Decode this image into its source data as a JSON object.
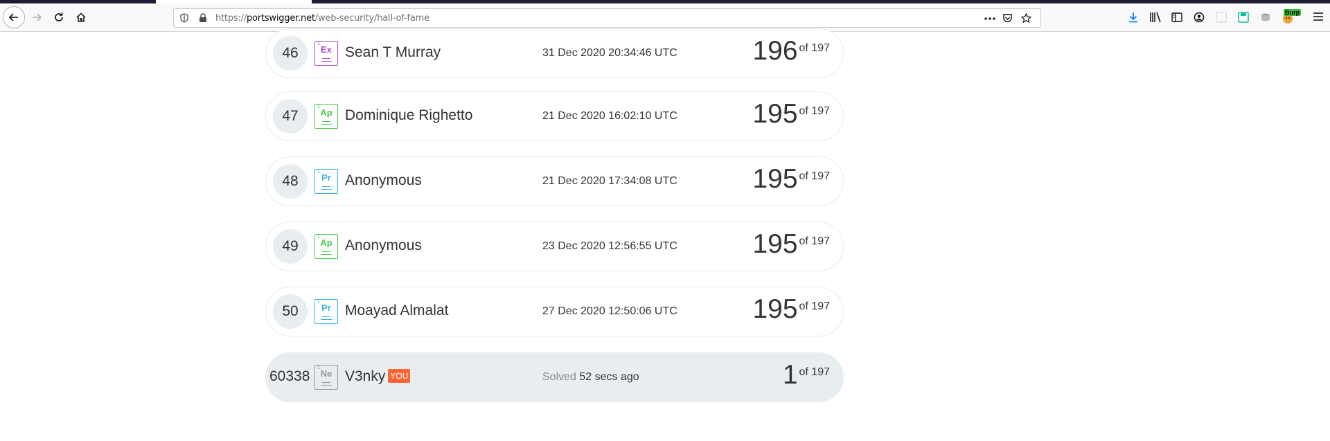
{
  "browser": {
    "url_prefix": "https://",
    "url_host": "portswigger.net",
    "url_path": "/web-security/hall-of-fame",
    "burp_label": "Burp"
  },
  "leaderboard": {
    "rows": [
      {
        "rank": "46",
        "badge": "Ex",
        "badge_color": "#a855c9",
        "name": "Sean T Murray",
        "date": "31 Dec 2020 20:34:46 UTC",
        "score": "196",
        "of": "of 197"
      },
      {
        "rank": "47",
        "badge": "Ap",
        "badge_color": "#4cc94c",
        "name": "Dominique Righetto",
        "date": "21 Dec 2020 16:02:10 UTC",
        "score": "195",
        "of": "of 197"
      },
      {
        "rank": "48",
        "badge": "Pr",
        "badge_color": "#3fb3e6",
        "name": "Anonymous",
        "date": "21 Dec 2020 17:34:08 UTC",
        "score": "195",
        "of": "of 197"
      },
      {
        "rank": "49",
        "badge": "Ap",
        "badge_color": "#4cc94c",
        "name": "Anonymous",
        "date": "23 Dec 2020 12:56:55 UTC",
        "score": "195",
        "of": "of 197"
      },
      {
        "rank": "50",
        "badge": "Pr",
        "badge_color": "#3fb3e6",
        "name": "Moayad Almalat",
        "date": "27 Dec 2020 12:50:06 UTC",
        "score": "195",
        "of": "of 197"
      }
    ],
    "you": {
      "rank": "60338",
      "badge": "Ne",
      "badge_color": "#9a9a9a",
      "name": "V3nky",
      "tag": "YOU",
      "solved_label": "Solved",
      "solved_time": "52 secs ago",
      "score": "1",
      "of": "of 197"
    }
  }
}
